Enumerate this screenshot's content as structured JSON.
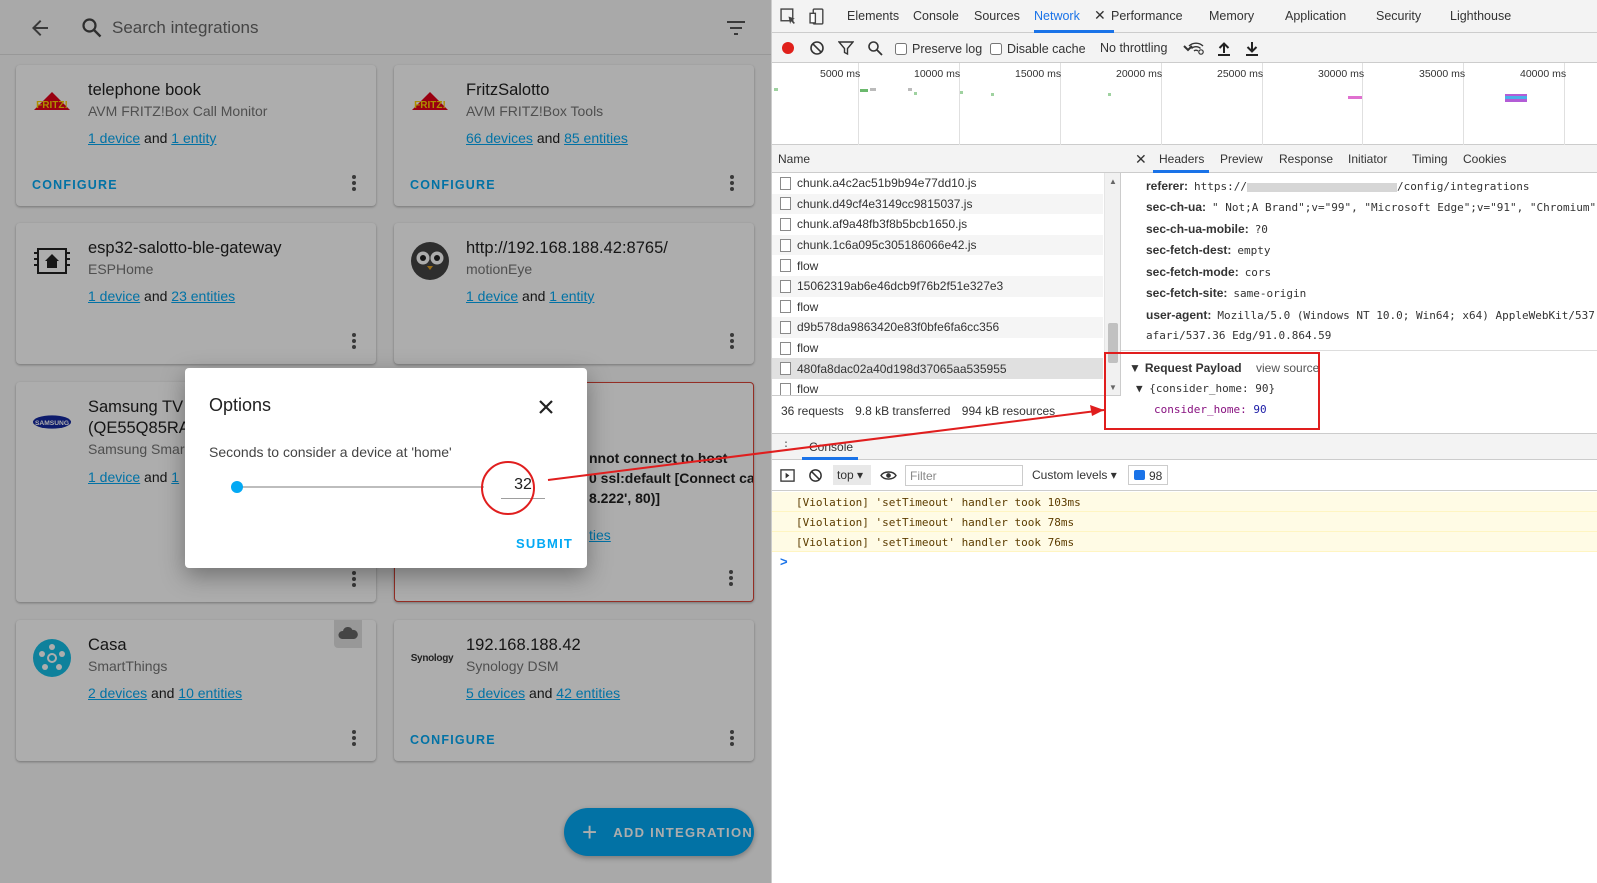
{
  "ha": {
    "search_placeholder": "Search integrations",
    "cards": [
      {
        "title": "telephone book",
        "subtitle": "AVM FRITZ!Box Call Monitor",
        "link1": "1 device",
        "and": "and",
        "link2": "1 entity",
        "configure": "CONFIGURE",
        "logo": "fritz-logo"
      },
      {
        "title": "FritzSalotto",
        "subtitle": "AVM FRITZ!Box Tools",
        "link1": "66 devices",
        "and": "and",
        "link2": "85 entities",
        "configure": "CONFIGURE",
        "logo": "fritz-logo"
      },
      {
        "title": "esp32-salotto-ble-gateway",
        "subtitle": "ESPHome",
        "link1": "1 device",
        "and": "and",
        "link2": "23 entities",
        "logo": "esphome-logo"
      },
      {
        "title": "http://192.168.188.42:8765/",
        "subtitle": "motionEye",
        "link1": "1 device",
        "and": "and",
        "link2": "1 entity",
        "logo": "motioneye-owl-logo"
      },
      {
        "title_line1": "Samsung TV",
        "title_line2": "(QE55Q85RA",
        "subtitle": "Samsung Smar",
        "link1": "1 device",
        "and": "and",
        "link2": "1",
        "logo": "samsung-logo"
      },
      {
        "error_line1": "nnot connect to host",
        "error_line2": "0 ssl:default [Connect call",
        "error_line3": "8.222', 80)]",
        "link": "ties"
      },
      {
        "title": "Casa",
        "subtitle": "SmartThings",
        "link1": "2 devices",
        "and": "and",
        "link2": "10 entities",
        "logo": "smartthings-logo"
      },
      {
        "title": "192.168.188.42",
        "subtitle": "Synology DSM",
        "link1": "5 devices",
        "and": "and",
        "link2": "42 entities",
        "configure": "CONFIGURE",
        "logo": "synology-logo",
        "logo_text": "Synology"
      }
    ],
    "add_integration": "ADD INTEGRATION",
    "dialog": {
      "title": "Options",
      "label": "Seconds to consider a device at 'home'",
      "value": "32",
      "slider_fraction": 0.02,
      "submit": "SUBMIT"
    }
  },
  "devtools": {
    "tabs": [
      "Elements",
      "Console",
      "Sources",
      "Network",
      "Performance",
      "Memory",
      "Application",
      "Security",
      "Lighthouse"
    ],
    "active_tab": "Network",
    "toolbar": {
      "preserve_log": "Preserve log",
      "disable_cache": "Disable cache",
      "throttling": "No throttling"
    },
    "timeline_labels": [
      "5000 ms",
      "10000 ms",
      "15000 ms",
      "20000 ms",
      "25000 ms",
      "30000 ms",
      "35000 ms",
      "40000 ms"
    ],
    "name_header": "Name",
    "requests": [
      "chunk.a4c2ac51b9b94e77dd10.js",
      "chunk.d49cf4e3149cc9815037.js",
      "chunk.af9a48fb3f8b5bcb1650.js",
      "chunk.1c6a095c305186066e42.js",
      "flow",
      "15062319ab6e46dcb9f76b2f51e327e3",
      "flow",
      "d9b578da9863420e83f0bfe6fa6cc356",
      "flow",
      "480fa8dac02a40d198d37065aa535955",
      "flow"
    ],
    "selected_request": 9,
    "status": {
      "requests": "36 requests",
      "transferred": "9.8 kB transferred",
      "resources": "994 kB resources"
    },
    "detail_tabs": [
      "Headers",
      "Preview",
      "Response",
      "Initiator",
      "Timing",
      "Cookies"
    ],
    "headers": [
      {
        "name": "referer:",
        "value_prefix": "https://",
        "value_suffix": "/config/integrations"
      },
      {
        "name": "sec-ch-ua:",
        "value": "\" Not;A Brand\";v=\"99\", \"Microsoft Edge\";v=\"91\", \"Chromium\""
      },
      {
        "name": "sec-ch-ua-mobile:",
        "value": "?0"
      },
      {
        "name": "sec-fetch-dest:",
        "value": "empty"
      },
      {
        "name": "sec-fetch-mode:",
        "value": "cors"
      },
      {
        "name": "sec-fetch-site:",
        "value": "same-origin"
      },
      {
        "name": "user-agent:",
        "value": "Mozilla/5.0 (Windows NT 10.0; Win64; x64) AppleWebKit/537"
      }
    ],
    "ua_wrap": "afari/537.36 Edg/91.0.864.59",
    "payload": {
      "title": "Request Payload",
      "view_source": "view source",
      "object": "{consider_home: 90}",
      "key": "consider_home:",
      "value": "90"
    },
    "console": {
      "tab": "Console",
      "context": "top",
      "filter_placeholder": "Filter",
      "levels": "Custom levels",
      "message_count": "98",
      "messages": [
        "[Violation] 'setTimeout' handler took 103ms",
        "[Violation] 'setTimeout' handler took 78ms",
        "[Violation] 'setTimeout' handler took 76ms"
      ],
      "prompt": ">"
    }
  },
  "colors": {
    "ha_accent": "#03a9f4",
    "devtools_accent": "#1a73e8",
    "annotation_red": "#e01e1e"
  }
}
